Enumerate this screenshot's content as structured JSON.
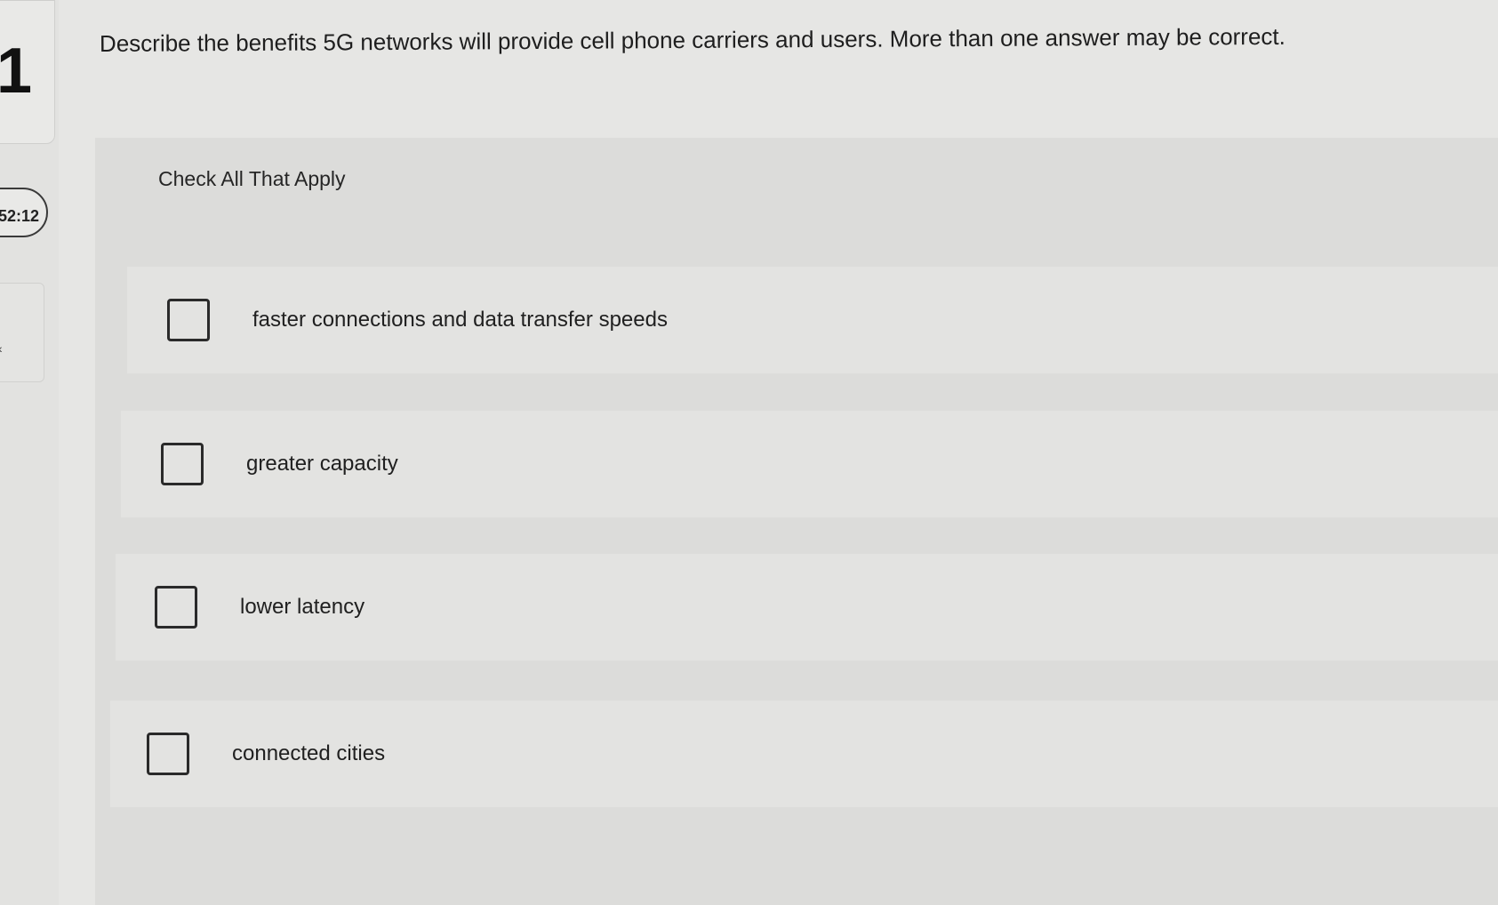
{
  "sidebar": {
    "question_number": "1",
    "timer": "52:12",
    "collapse_glyph": "‹"
  },
  "question": {
    "prompt": "Describe the benefits 5G networks will provide cell phone carriers and users. More than one answer may be correct.",
    "instruction": "Check All That Apply",
    "options": [
      {
        "label": "faster connections and data transfer speeds",
        "checked": false
      },
      {
        "label": "greater capacity",
        "checked": false
      },
      {
        "label": "lower latency",
        "checked": false
      },
      {
        "label": "connected cities",
        "checked": false
      }
    ]
  },
  "colors": {
    "background": "#e6e6e4",
    "panel": "#dcdcda",
    "text": "#1f1f1f",
    "checkbox_border": "#2a2a2a"
  }
}
